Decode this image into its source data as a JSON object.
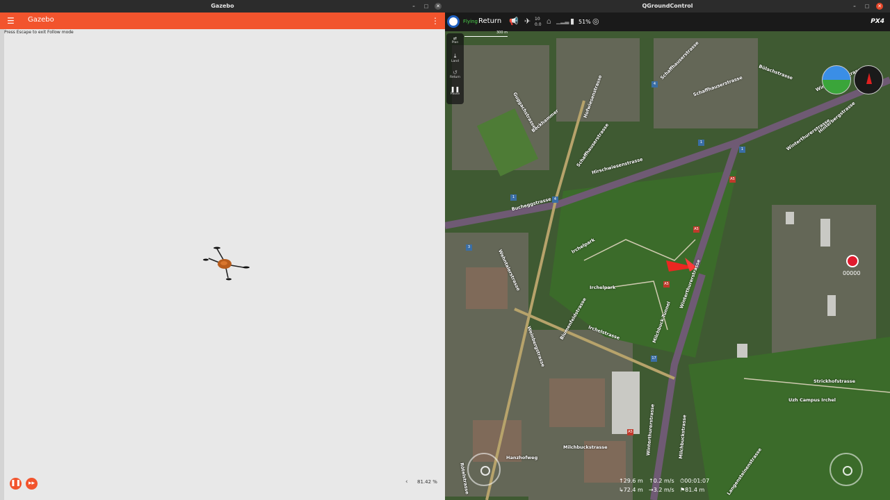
{
  "gazebo": {
    "window_title": "Gazebo",
    "app_title": "Gazebo",
    "hint": "Press Escape to exit Follow mode",
    "rtf": "81.42 %",
    "icons": [
      "menu-icon",
      "kebab-icon",
      "pause-icon",
      "step-icon",
      "chevron-left-icon"
    ],
    "accent_color": "#f2542d"
  },
  "qgc": {
    "window_title": "QGroundControl",
    "status": "Flying",
    "mode": "Return",
    "sats": "10",
    "hdop": "0.0",
    "battery": "51%",
    "brand": "PX4",
    "scale_label": "300 m",
    "tools": {
      "plan": "Plan",
      "land": "Land",
      "return": "Return",
      "pause": "Pause"
    },
    "record_count": "00000",
    "telemetry": {
      "alt": "29.6 m",
      "vspeed": "0.2 m/s",
      "time": "00:01:07",
      "dist_home": "72.4 m",
      "hspeed": "3.2 m/s",
      "dist": "81.4 m"
    },
    "map_labels": [
      "Schaffhauserstrasse",
      "Hirschwiesenstrasse",
      "Bucheggstrasse",
      "Wehntalerstrasse",
      "Irchelpark",
      "Irchelstrasse",
      "Milchbuck-Tunnel",
      "Winterthurerstrasse",
      "Uzh Campus Irchel",
      "Bülachstrasse",
      "Milchbuckstrasse",
      "Langensteinenstrasse",
      "Strickhofstrasse",
      "Hinterbergstrasse",
      "Guggachstrasse",
      "Beckhammer",
      "Hofwiesenstrasse",
      "Schaffhauserstrasse",
      "Blumenfeldstrasse",
      "Hanzhofweg",
      "Rötelstrasse",
      "Weinbergstrasse",
      "Winterthurerstrasse",
      "Milchbuckstrasse",
      "Winterthurerstrasse",
      "Winterthurerstrasse",
      "Schaffhauserstrasse",
      "Irchelpark"
    ],
    "road_badges": [
      "4",
      "1",
      "1",
      "A5",
      "1",
      "4",
      "3",
      "A5",
      "A5",
      "A5",
      "17",
      "A5"
    ],
    "accent_color": "#4ad14a"
  }
}
